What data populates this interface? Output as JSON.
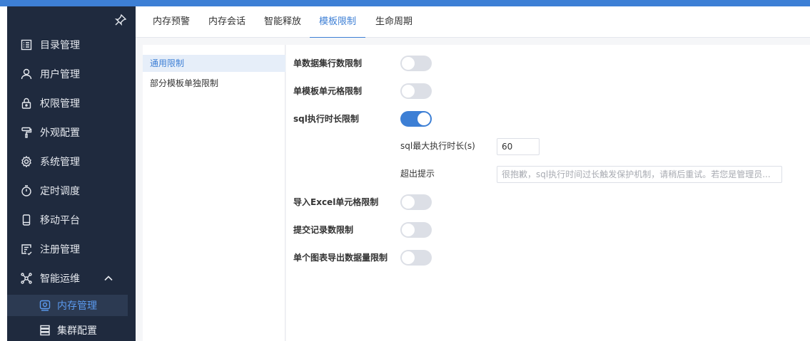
{
  "sidebar": {
    "items": [
      {
        "label": "目录管理",
        "icon": "list-icon"
      },
      {
        "label": "用户管理",
        "icon": "user-icon"
      },
      {
        "label": "权限管理",
        "icon": "lock-icon"
      },
      {
        "label": "外观配置",
        "icon": "paint-roller-icon"
      },
      {
        "label": "系统管理",
        "icon": "gear-icon"
      },
      {
        "label": "定时调度",
        "icon": "timer-icon"
      },
      {
        "label": "移动平台",
        "icon": "mobile-icon"
      },
      {
        "label": "注册管理",
        "icon": "register-icon"
      },
      {
        "label": "智能运维",
        "icon": "network-icon"
      }
    ],
    "sub_items": [
      {
        "label": "内存管理",
        "icon": "memory-icon",
        "active": true
      },
      {
        "label": "集群配置",
        "icon": "cluster-icon",
        "active": false
      }
    ]
  },
  "tabs": [
    {
      "label": "内存预警"
    },
    {
      "label": "内存会话"
    },
    {
      "label": "智能释放"
    },
    {
      "label": "模板限制",
      "active": true
    },
    {
      "label": "生命周期"
    }
  ],
  "left_menu": {
    "items": [
      {
        "label": "通用限制",
        "active": true
      },
      {
        "label": "部分模板单独限制",
        "active": false
      }
    ]
  },
  "settings": {
    "dataset_rows": {
      "label": "单数据集行数限制",
      "enabled": false
    },
    "template_cells": {
      "label": "单模板单元格限制",
      "enabled": false
    },
    "sql_timeout": {
      "label": "sql执行时长限制",
      "enabled": true,
      "max_time_label": "sql最大执行时长(s)",
      "max_time_value": "60",
      "tip_label": "超出提示",
      "tip_placeholder": "很抱歉，sql执行时间过长触发保护机制，请稍后重试。若您是管理员..."
    },
    "excel_cells": {
      "label": "导入Excel单元格限制",
      "enabled": false
    },
    "submit_records": {
      "label": "提交记录数限制",
      "enabled": false
    },
    "chart_export": {
      "label": "单个图表导出数据量限制",
      "enabled": false
    }
  },
  "colors": {
    "accent": "#3d7fd5",
    "sidebar_bg": "#1f2a3e"
  }
}
